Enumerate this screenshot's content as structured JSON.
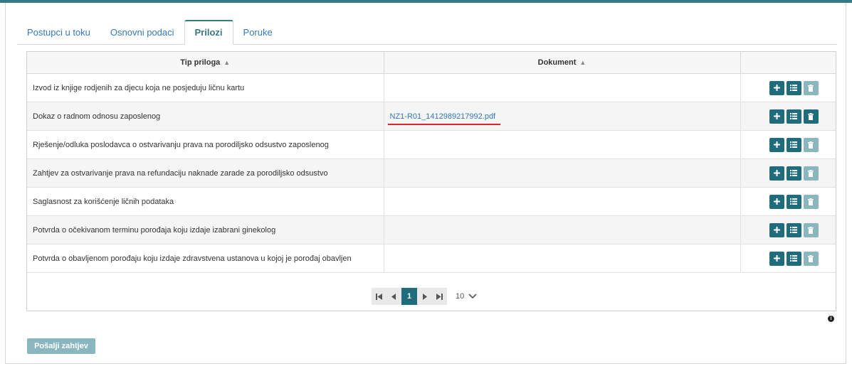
{
  "tabs": [
    {
      "label": "Postupci u toku"
    },
    {
      "label": "Osnovni podaci"
    },
    {
      "label": "Prilozi"
    },
    {
      "label": "Poruke"
    }
  ],
  "active_tab": "Prilozi",
  "table": {
    "columns": [
      "Tip priloga",
      "Dokument",
      ""
    ],
    "rows": [
      {
        "tip": "Izvod iz knjige rodjenih za djecu koja ne posjeduju ličnu kartu",
        "dokument": "",
        "delete_enabled": false
      },
      {
        "tip": "Dokaz o radnom odnosu zaposlenog",
        "dokument": "NZ1-R01_1412989217992.pdf",
        "delete_enabled": true
      },
      {
        "tip": "Rješenje/odluka poslodavca o ostvarivanju prava na porodiljsko odsustvo zaposlenog",
        "dokument": "",
        "delete_enabled": false
      },
      {
        "tip": "Zahtjev za ostvarivanje prava na refundaciju naknade zarade za porodiljsko odsustvo",
        "dokument": "",
        "delete_enabled": false
      },
      {
        "tip": "Saglasnost za korišćenje ličnih podataka",
        "dokument": "",
        "delete_enabled": false
      },
      {
        "tip": "Potvrda o očekivanom terminu porođaja koju izdaje izabrani ginekolog",
        "dokument": "",
        "delete_enabled": false
      },
      {
        "tip": "Potvrda o obavljenom porođaju koju izdaje zdravstvena ustanova u kojoj je porođaj obavljen",
        "dokument": "",
        "delete_enabled": false
      }
    ]
  },
  "pager": {
    "current_page": "1",
    "page_size": "10"
  },
  "send_button": "Pošalji zahtjev",
  "colors": {
    "accent": "#1f6d7c",
    "accent_disabled": "#8ab7bf",
    "link": "#337ab7",
    "underline": "#d9252c"
  }
}
